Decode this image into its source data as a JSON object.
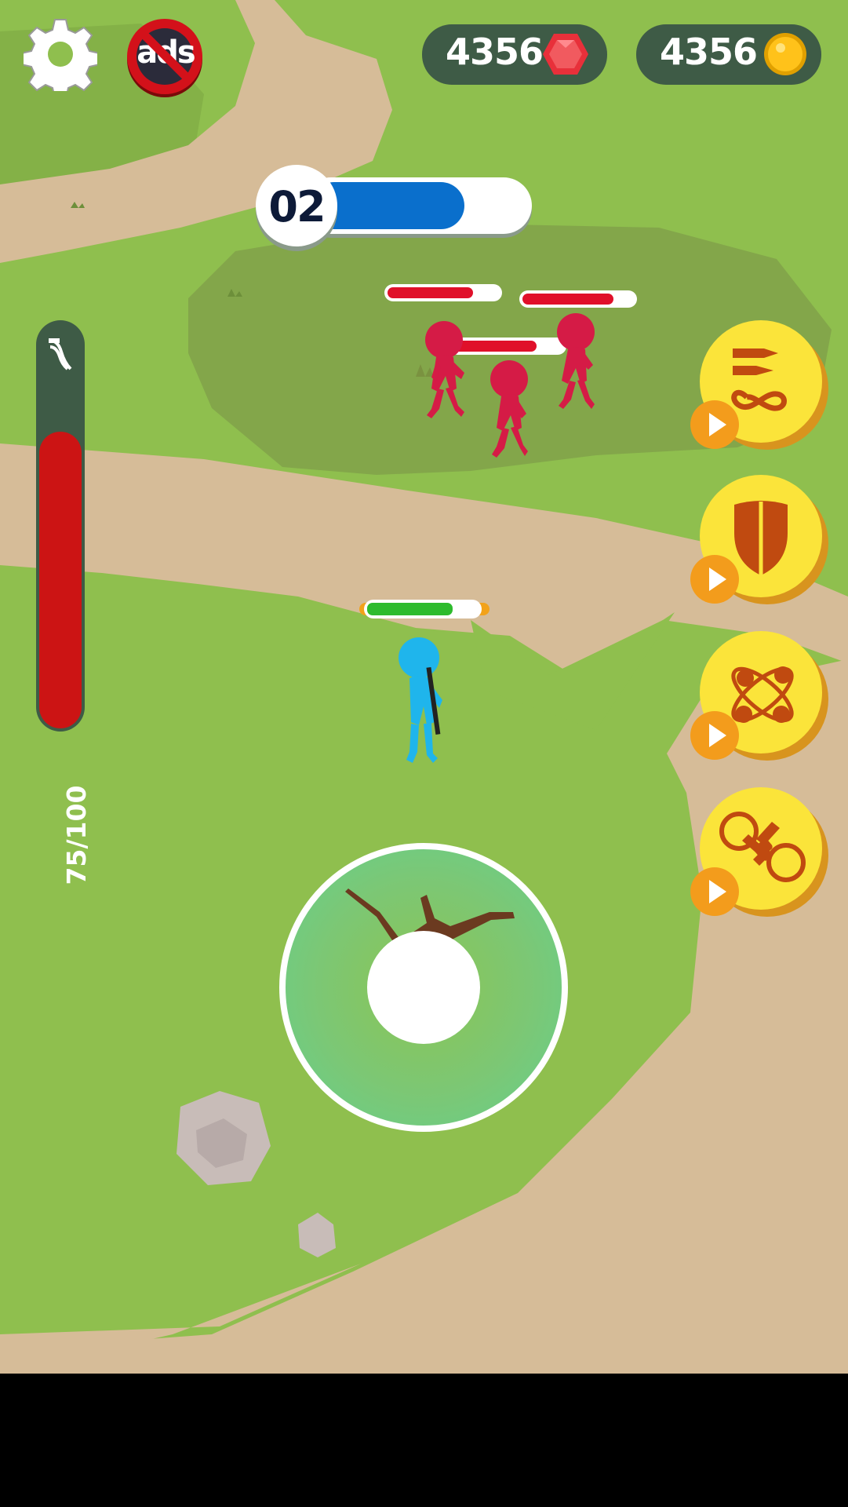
{
  "hud": {
    "settings_icon": "gear-icon",
    "no_ads_label": "ads",
    "gems": {
      "value": "4356",
      "icon": "red-gem-icon"
    },
    "coins": {
      "value": "4356",
      "icon": "gold-coin-icon"
    }
  },
  "level": {
    "number": "02",
    "progress": 0.72
  },
  "ammo": {
    "label": "75/100",
    "current": 75,
    "max": 100,
    "icon": "ammo-clip-icon"
  },
  "enemies": [
    {
      "name": "red-stickman",
      "health": 0.77
    },
    {
      "name": "red-stickman",
      "health": 0.82
    },
    {
      "name": "red-stickman",
      "health": 0.76
    }
  ],
  "player": {
    "name": "blue-stickman-gunner",
    "health": 0.77
  },
  "powerups": [
    {
      "name": "infinite-ammo",
      "icon": "bullets-infinity-icon"
    },
    {
      "name": "shield",
      "icon": "shield-icon"
    },
    {
      "name": "multi-shot",
      "icon": "atom-icon"
    },
    {
      "name": "drone",
      "icon": "drone-icon"
    }
  ],
  "colors": {
    "grass": "#8fbf4e",
    "path": "#d6bc98",
    "hud_pill": "#3e5b46",
    "level_bar": "#0a6fcc",
    "enemy_health": "#e0102a",
    "player_health": "#2dbb2d",
    "ammo_bar": "#cc1414",
    "powerup": "#fbe43a",
    "play": "#f39c1c"
  }
}
